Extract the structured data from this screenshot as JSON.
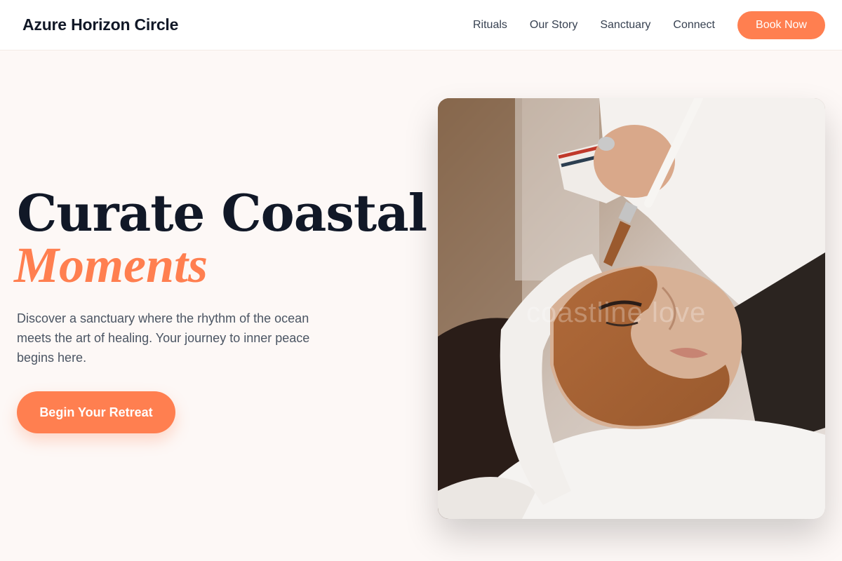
{
  "header": {
    "brand": "Azure Horizon Circle",
    "nav": [
      "Rituals",
      "Our Story",
      "Sanctuary",
      "Connect"
    ],
    "cta_label": "Book Now"
  },
  "hero": {
    "headline": "Curate Coastal",
    "headline_accent": "Moments",
    "lead": "Discover a sanctuary where the rhythm of the ocean meets the art of healing. Your journey to inner peace begins here.",
    "cta_label": "Begin Your Retreat"
  },
  "photo": {
    "subject": "spa facial treatment with brush applying clay mask",
    "watermark": "coastline love"
  },
  "colors": {
    "accent": "#ff7f50",
    "background": "#fdf8f6",
    "text_dark": "#111827",
    "text_muted": "#4b5563"
  }
}
